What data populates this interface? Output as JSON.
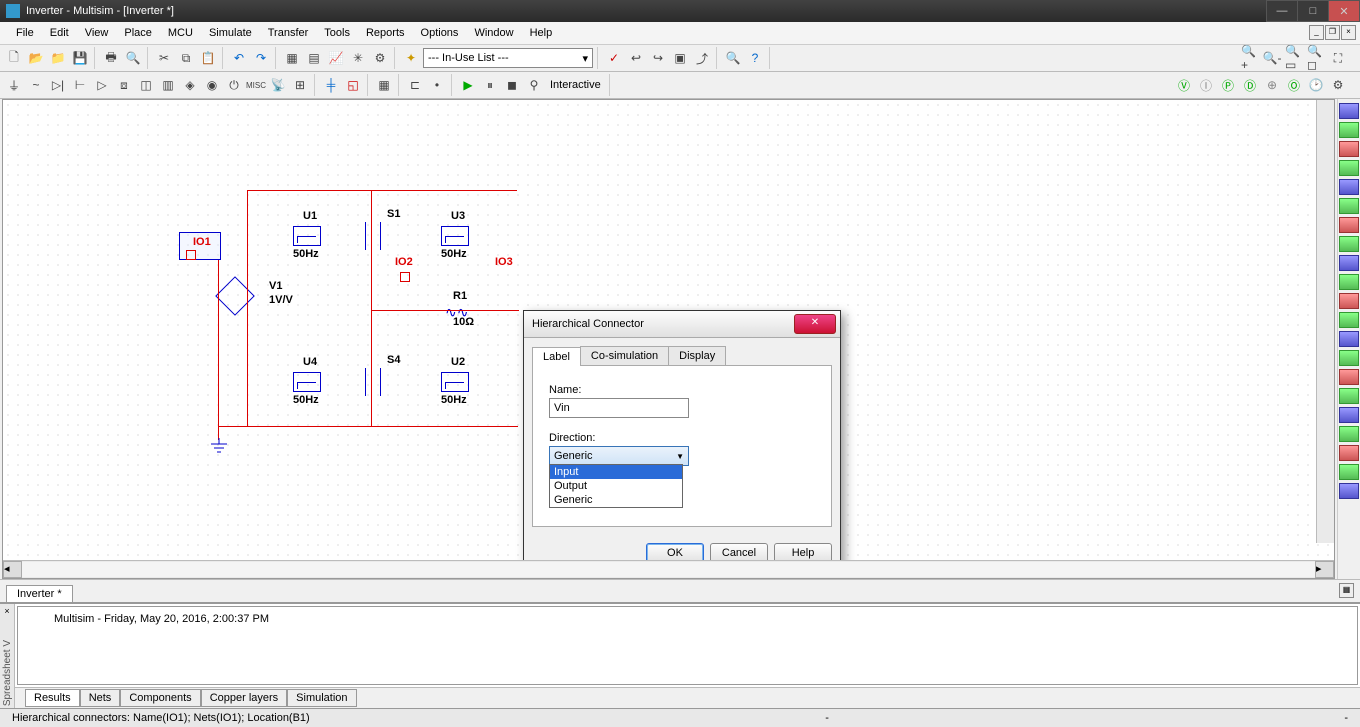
{
  "app": {
    "title": "Inverter - Multisim - [Inverter *]"
  },
  "window_controls": {
    "min": "—",
    "max": "□",
    "close": "✕"
  },
  "menu": [
    "File",
    "Edit",
    "View",
    "Place",
    "MCU",
    "Simulate",
    "Transfer",
    "Tools",
    "Reports",
    "Options",
    "Window",
    "Help"
  ],
  "mdi_controls": {
    "min": "_",
    "restore": "❐",
    "close": "×"
  },
  "toolbar": {
    "inuse_list": "--- In-Use List ---",
    "interactive": "Interactive"
  },
  "document_tab": "Inverter *",
  "spreadsheet": {
    "handle": "Spreadsheet V",
    "message": "Multisim  -  Friday, May 20, 2016, 2:00:37 PM",
    "tabs": [
      "Results",
      "Nets",
      "Components",
      "Copper layers",
      "Simulation"
    ]
  },
  "statusbar": {
    "left": "Hierarchical connectors: Name(IO1); Nets(IO1); Location(B1)",
    "mid": "-",
    "right": "-"
  },
  "schematic": {
    "io1": "IO1",
    "io2": "IO2",
    "io3": "IO3",
    "u1": "U1",
    "u2": "U2",
    "u3": "U3",
    "u4": "U4",
    "s1": "S1",
    "s4": "S4",
    "r1": "R1",
    "r1_val": "10Ω",
    "v1": "V1",
    "v1_val": "1V/V",
    "freq": "50Hz"
  },
  "dialog": {
    "title": "Hierarchical Connector",
    "tabs": [
      "Label",
      "Co-simulation",
      "Display"
    ],
    "name_label": "Name:",
    "name_value": "Vin",
    "direction_label": "Direction:",
    "direction_value": "Generic",
    "direction_options": [
      "Input",
      "Output",
      "Generic"
    ],
    "buttons": {
      "ok": "OK",
      "cancel": "Cancel",
      "help": "Help"
    }
  }
}
